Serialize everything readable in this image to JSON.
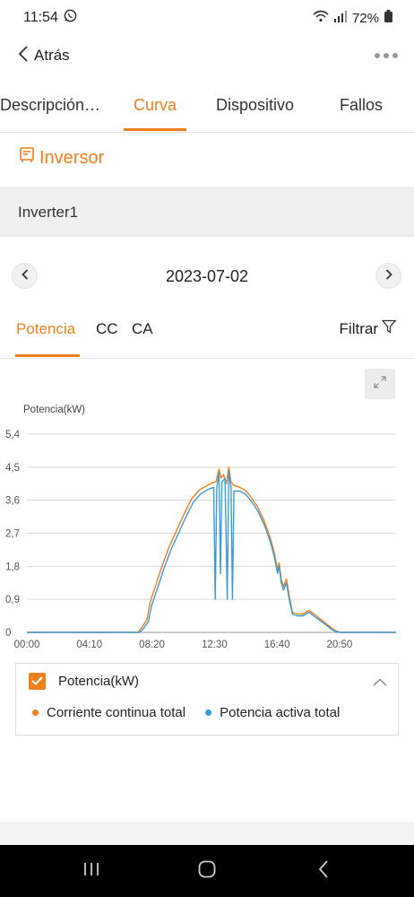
{
  "status": {
    "time": "11:54",
    "battery": "72%"
  },
  "header": {
    "back_label": "Atrás"
  },
  "tabs": [
    {
      "label": "Descripción…"
    },
    {
      "label": "Curva"
    },
    {
      "label": "Dispositivo"
    },
    {
      "label": "Fallos"
    }
  ],
  "section": {
    "title": "Inversor"
  },
  "device": {
    "name": "Inverter1"
  },
  "date": {
    "value": "2023-07-02"
  },
  "subtabs": [
    {
      "label": "Potencia"
    },
    {
      "label": "CC"
    },
    {
      "label": "CA"
    }
  ],
  "filter": {
    "label": "Filtrar"
  },
  "legend": {
    "title": "Potencia(kW)",
    "items": [
      {
        "label": "Corriente continua total",
        "color": "#f07f1e"
      },
      {
        "label": "Potencia activa total",
        "color": "#3a9bd9"
      }
    ]
  },
  "colors": {
    "accent": "#f07f1e",
    "series_dc": "#f07f1e",
    "series_ac": "#3a9bd9"
  },
  "icons": {
    "back": "chevron-left-icon",
    "more": "more-dots-icon",
    "expand": "expand-icon",
    "filter": "filter-icon",
    "inverter": "inverter-icon"
  },
  "chart_data": {
    "type": "line",
    "ylabel": "Potencia(kW)",
    "ylim": [
      0,
      5.4
    ],
    "yticks": [
      "0",
      "0,9",
      "1,8",
      "2,7",
      "3,6",
      "4,5",
      "5,4"
    ],
    "xticks": [
      "00:00",
      "04:10",
      "08:20",
      "12:30",
      "16:40",
      "20:50"
    ],
    "x_unit": "hours",
    "xlim": [
      0,
      24.6
    ],
    "grid": true,
    "series": [
      {
        "name": "Corriente continua total",
        "points": [
          [
            0,
            0
          ],
          [
            7.4,
            0
          ],
          [
            7.6,
            0.1
          ],
          [
            8.0,
            0.35
          ],
          [
            8.2,
            0.8
          ],
          [
            8.6,
            1.3
          ],
          [
            9.0,
            1.8
          ],
          [
            9.5,
            2.35
          ],
          [
            10.0,
            2.8
          ],
          [
            10.5,
            3.25
          ],
          [
            11.0,
            3.65
          ],
          [
            11.5,
            3.88
          ],
          [
            12.0,
            4.0
          ],
          [
            12.4,
            4.08
          ],
          [
            12.6,
            4.1
          ],
          [
            12.8,
            4.45
          ],
          [
            12.95,
            4.2
          ],
          [
            13.1,
            4.3
          ],
          [
            13.3,
            4.05
          ],
          [
            13.45,
            4.5
          ],
          [
            13.6,
            4.1
          ],
          [
            13.8,
            4.0
          ],
          [
            14.2,
            3.95
          ],
          [
            14.6,
            3.85
          ],
          [
            15.0,
            3.65
          ],
          [
            15.4,
            3.4
          ],
          [
            15.8,
            3.05
          ],
          [
            16.2,
            2.6
          ],
          [
            16.5,
            2.15
          ],
          [
            16.7,
            1.7
          ],
          [
            16.8,
            1.9
          ],
          [
            16.95,
            1.45
          ],
          [
            17.1,
            1.25
          ],
          [
            17.3,
            1.45
          ],
          [
            17.5,
            0.95
          ],
          [
            17.7,
            0.55
          ],
          [
            18.0,
            0.5
          ],
          [
            18.4,
            0.5
          ],
          [
            18.8,
            0.6
          ],
          [
            19.2,
            0.48
          ],
          [
            19.6,
            0.35
          ],
          [
            20.0,
            0.22
          ],
          [
            20.3,
            0.12
          ],
          [
            20.6,
            0.04
          ],
          [
            20.9,
            0
          ],
          [
            24.6,
            0
          ]
        ]
      },
      {
        "name": "Potencia activa total",
        "points": [
          [
            0,
            0
          ],
          [
            7.5,
            0
          ],
          [
            7.7,
            0.07
          ],
          [
            8.1,
            0.3
          ],
          [
            8.3,
            0.72
          ],
          [
            8.7,
            1.2
          ],
          [
            9.1,
            1.7
          ],
          [
            9.6,
            2.25
          ],
          [
            10.1,
            2.7
          ],
          [
            10.6,
            3.15
          ],
          [
            11.1,
            3.55
          ],
          [
            11.6,
            3.78
          ],
          [
            12.1,
            3.9
          ],
          [
            12.45,
            3.95
          ],
          [
            12.55,
            0.9
          ],
          [
            12.65,
            3.95
          ],
          [
            12.8,
            4.35
          ],
          [
            12.9,
            1.6
          ],
          [
            13.0,
            4.1
          ],
          [
            13.2,
            4.2
          ],
          [
            13.35,
            0.9
          ],
          [
            13.45,
            4.4
          ],
          [
            13.6,
            3.95
          ],
          [
            13.7,
            0.9
          ],
          [
            13.8,
            3.85
          ],
          [
            14.2,
            3.85
          ],
          [
            14.6,
            3.75
          ],
          [
            15.0,
            3.55
          ],
          [
            15.4,
            3.3
          ],
          [
            15.8,
            2.95
          ],
          [
            16.2,
            2.5
          ],
          [
            16.5,
            2.05
          ],
          [
            16.7,
            1.6
          ],
          [
            16.8,
            1.8
          ],
          [
            16.95,
            1.35
          ],
          [
            17.1,
            1.15
          ],
          [
            17.3,
            1.35
          ],
          [
            17.5,
            0.85
          ],
          [
            17.7,
            0.5
          ],
          [
            18.0,
            0.45
          ],
          [
            18.4,
            0.45
          ],
          [
            18.8,
            0.55
          ],
          [
            19.2,
            0.42
          ],
          [
            19.6,
            0.3
          ],
          [
            20.0,
            0.18
          ],
          [
            20.3,
            0.08
          ],
          [
            20.6,
            0.02
          ],
          [
            20.9,
            0
          ],
          [
            24.6,
            0
          ]
        ]
      }
    ]
  }
}
